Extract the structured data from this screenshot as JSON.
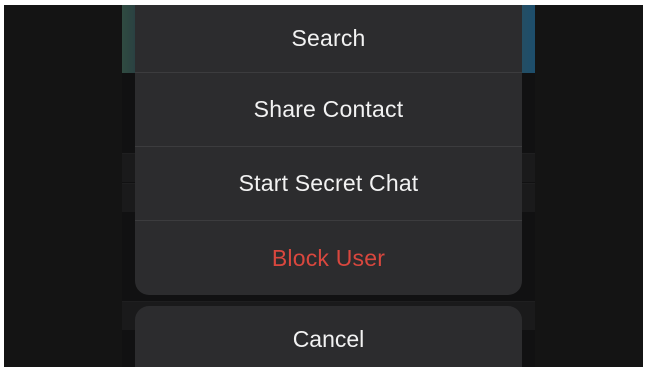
{
  "action_sheet": {
    "items": [
      {
        "label": "Search",
        "style": "default"
      },
      {
        "label": "Share Contact",
        "style": "default"
      },
      {
        "label": "Start Secret Chat",
        "style": "default"
      },
      {
        "label": "Block User",
        "style": "destructive"
      }
    ],
    "cancel_label": "Cancel"
  },
  "colors": {
    "sheet_background": "#2c2c2e",
    "text": "#f2f2f2",
    "destructive": "#d9473e",
    "backdrop": "#141414"
  }
}
